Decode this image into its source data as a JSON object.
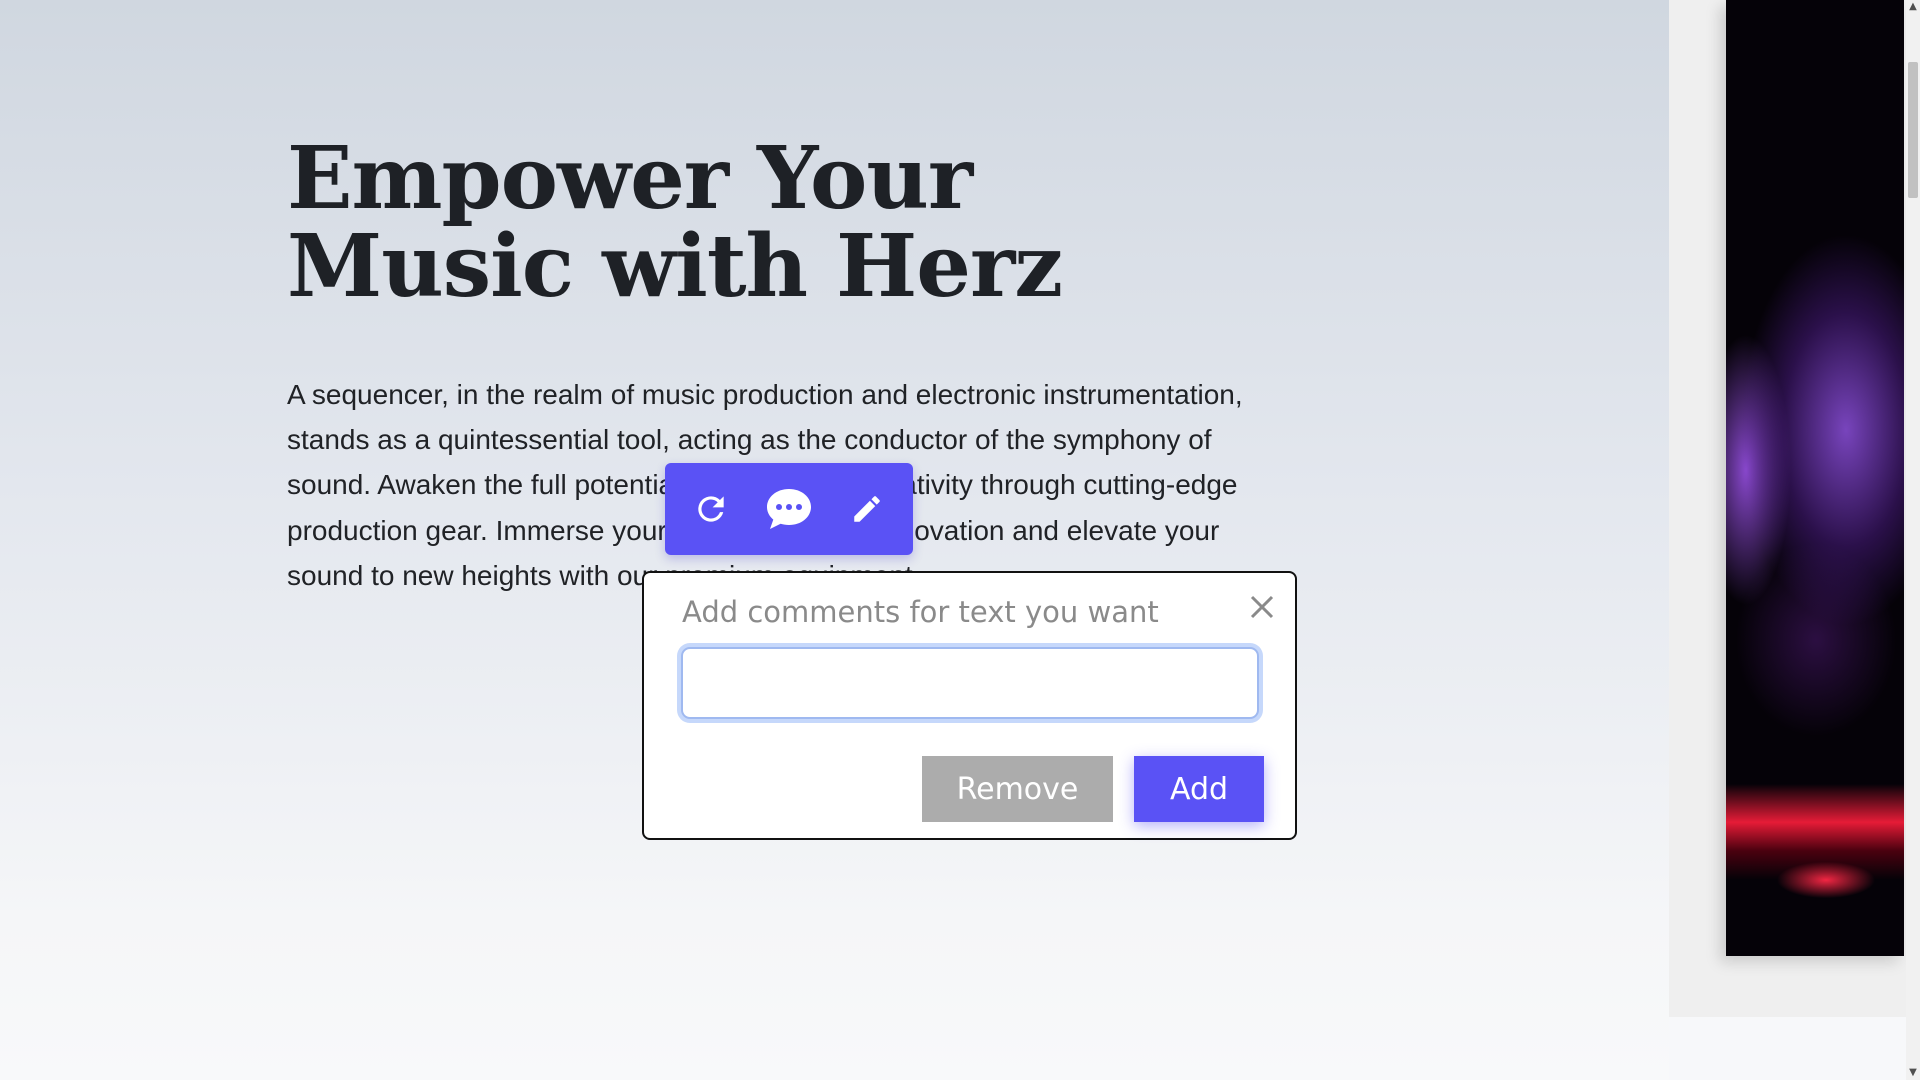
{
  "hero": {
    "headline": "Empower Your Music with Herz",
    "body": "A sequencer, in the realm of music production and electronic instrumentation, stands as a quintessential tool, acting as the conductor of the symphony of sound. Awaken the full potential of your music creativity through cutting-edge production gear. Immerse yourself in a world of innovation and elevate your sound to new heights with our premium equipment."
  },
  "toolbar": {
    "icons": [
      "refresh-icon",
      "comment-icon",
      "pencil-icon"
    ],
    "color": "#5a52f5"
  },
  "comment_dialog": {
    "title": "Add comments for text you want",
    "input_value": "",
    "remove_label": "Remove",
    "add_label": "Add",
    "accent": "#5a52f5",
    "remove_color": "#acacac"
  },
  "scrollbar": {
    "up_arrow": "▲",
    "down_arrow": "▼"
  }
}
